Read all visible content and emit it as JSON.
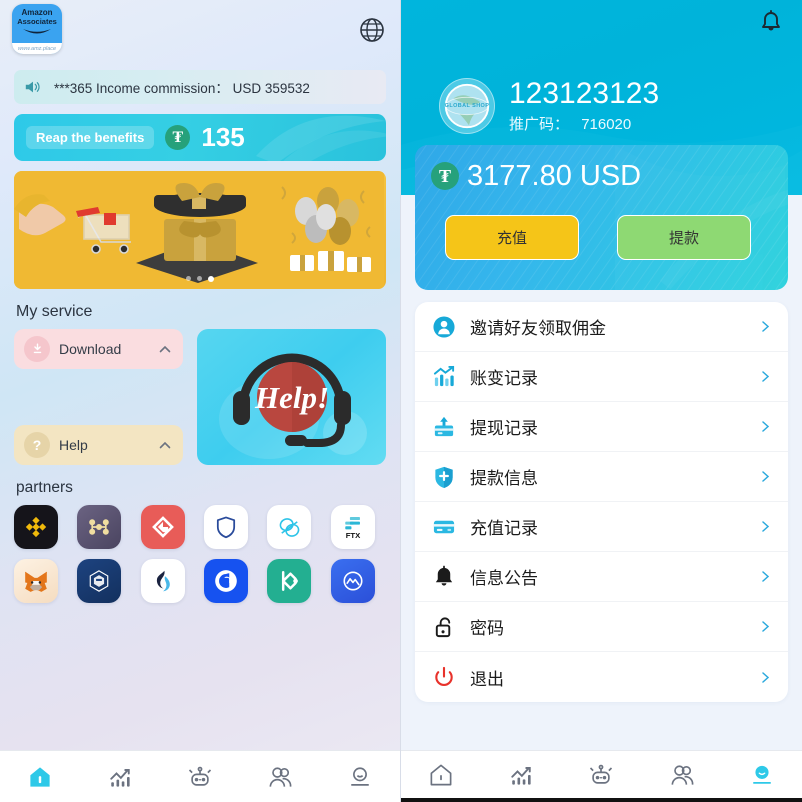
{
  "left": {
    "logo": {
      "line1": "Amazon",
      "line2": "Associates",
      "url": "www.amz.place",
      "icon": "amazon-associates-logo"
    },
    "language_icon": "globe-icon",
    "notice": {
      "icon": "speaker-icon",
      "text": "***365 Income commission： USD 359532"
    },
    "benefit": {
      "label": "Reap the benefits",
      "currency_icon": "usdt-icon",
      "amount": "135"
    },
    "banner": {
      "alt": "gift-promo-banner",
      "dots": 3,
      "active_dot": 3
    },
    "service_title": "My service",
    "services": [
      {
        "label": "Download",
        "icon": "download-icon",
        "chevron": "chevron-up-icon",
        "color": "#fadde0"
      },
      {
        "label": "Help",
        "icon": "question-mark-icon",
        "chevron": "chevron-up-icon",
        "color": "#f3e5c2"
      }
    ],
    "help_card": {
      "label": "Help!",
      "icon": "headset-support-icon"
    },
    "partners_title": "partners",
    "partners": [
      {
        "name": "binance-icon"
      },
      {
        "name": "nodes-icon"
      },
      {
        "name": "gate-io-icon"
      },
      {
        "name": "shield-wallet-icon"
      },
      {
        "name": "uniswap-icon"
      },
      {
        "name": "ftx-icon"
      },
      {
        "name": "metamask-icon"
      },
      {
        "name": "crypto-com-icon"
      },
      {
        "name": "huobi-icon"
      },
      {
        "name": "coinbase-icon"
      },
      {
        "name": "kucoin-icon"
      },
      {
        "name": "coinmarketcap-icon"
      }
    ],
    "nav": [
      {
        "name": "home-icon",
        "active": true
      },
      {
        "name": "chart-icon",
        "active": false
      },
      {
        "name": "robot-icon",
        "active": false
      },
      {
        "name": "users-icon",
        "active": false
      },
      {
        "name": "profile-icon",
        "active": false
      }
    ]
  },
  "right": {
    "bell_icon": "bell-icon",
    "avatar": {
      "icon": "global-shop-globe-icon",
      "text": "GLOBAL SHOP"
    },
    "username": "123123123",
    "promo_code_label": "推广码：",
    "promo_code_value": "716020",
    "balance": {
      "currency_icon": "usdt-icon",
      "amount": "3177.80 USD"
    },
    "actions": [
      {
        "label": "充值",
        "name": "recharge-button",
        "color": "#f5c518"
      },
      {
        "label": "提款",
        "name": "withdraw-button",
        "color": "#8ed973"
      }
    ],
    "menu": [
      {
        "label": "邀请好友领取佣金",
        "icon": "user-circle-icon"
      },
      {
        "label": "账变记录",
        "icon": "chart-bars-icon"
      },
      {
        "label": "提现记录",
        "icon": "card-upload-icon"
      },
      {
        "label": "提款信息",
        "icon": "shield-plus-icon"
      },
      {
        "label": "充值记录",
        "icon": "credit-card-icon"
      },
      {
        "label": "信息公告",
        "icon": "bell-filled-icon"
      },
      {
        "label": "密码",
        "icon": "lock-open-icon"
      },
      {
        "label": "退出",
        "icon": "power-icon"
      }
    ],
    "nav": [
      {
        "name": "home-icon",
        "active": false
      },
      {
        "name": "chart-icon",
        "active": false
      },
      {
        "name": "robot-icon",
        "active": false
      },
      {
        "name": "users-icon",
        "active": false
      },
      {
        "name": "profile-icon",
        "active": true
      }
    ]
  },
  "colors": {
    "accent_cyan": "#2ec9e8",
    "hero_blue": "#00b5dd",
    "recharge_yellow": "#f5c518",
    "withdraw_green": "#8ed973",
    "usdt_green": "#26a17b"
  }
}
